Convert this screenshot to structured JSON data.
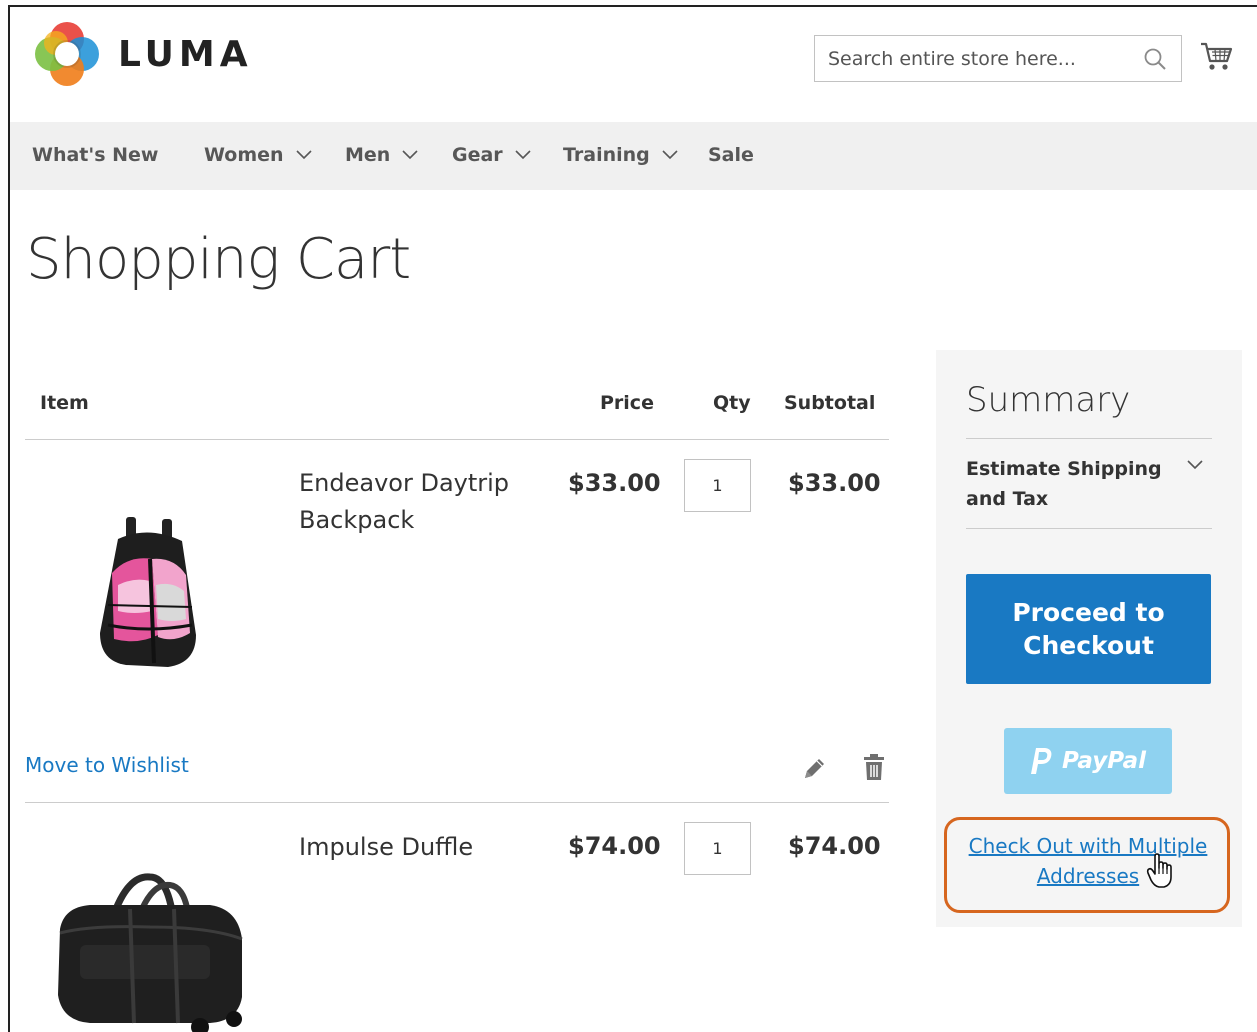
{
  "header": {
    "logo_text": "LUMA",
    "logo_colors": [
      "#e8423b",
      "#f5b21b",
      "#7bc043",
      "#1a8fd6",
      "#f07d1a"
    ],
    "search": {
      "placeholder": "Search entire store here..."
    },
    "search_icon": "search-icon",
    "cart_icon": "shopping-cart-icon"
  },
  "nav": {
    "items": [
      {
        "label": "What's New",
        "has_dropdown": false
      },
      {
        "label": "Women",
        "has_dropdown": true
      },
      {
        "label": "Men",
        "has_dropdown": true
      },
      {
        "label": "Gear",
        "has_dropdown": true
      },
      {
        "label": "Training",
        "has_dropdown": true
      },
      {
        "label": "Sale",
        "has_dropdown": false
      }
    ]
  },
  "page": {
    "title": "Shopping Cart"
  },
  "cart": {
    "columns": [
      "Item",
      "Price",
      "Qty",
      "Subtotal"
    ],
    "items": [
      {
        "name": "Endeavor Daytrip Backpack",
        "price": "$33.00",
        "qty": "1",
        "subtotal": "$33.00",
        "image_icon": "backpack-image"
      },
      {
        "name": "Impulse Duffle",
        "price": "$74.00",
        "qty": "1",
        "subtotal": "$74.00",
        "image_icon": "duffle-bag-image"
      }
    ],
    "actions": {
      "move_to_wishlist": "Move to Wishlist",
      "edit_icon": "pencil-icon",
      "delete_icon": "trash-icon"
    }
  },
  "summary": {
    "title": "Summary",
    "estimate_label": "Estimate Shipping and Tax",
    "checkout_label": "Proceed to Checkout",
    "paypal_label": "PayPal",
    "multi_address_label": "Check Out with Multiple Addresses",
    "accent_color": "#1979c3",
    "highlight_color": "#d6661f"
  }
}
